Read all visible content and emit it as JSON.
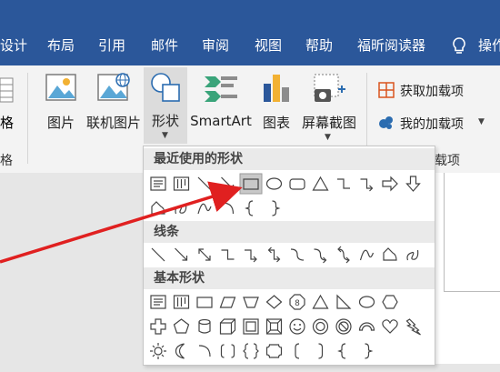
{
  "tabs": [
    "设计",
    "布局",
    "引用",
    "邮件",
    "审阅",
    "视图",
    "帮助",
    "福昕阅读器",
    "操作"
  ],
  "ribbon": {
    "left_partial_label": "格",
    "left_partial_group": "格",
    "picture_label": "图片",
    "online_picture_label": "联机图片",
    "shapes_label": "形状",
    "smartart_label": "SmartArt",
    "chart_label": "图表",
    "screenshot_label": "屏幕截图",
    "get_addins_label": "获取加载项",
    "my_addins_label": "我的加载项",
    "addins_group_label": "载项"
  },
  "dropdown": {
    "recent_header": "最近使用的形状",
    "lines_header": "线条",
    "basic_header": "基本形状",
    "recent_icons": [
      "text-box-icon",
      "vertical-text-box-icon",
      "line-icon",
      "arrow-line-icon",
      "rectangle-icon",
      "oval-icon",
      "rounded-rectangle-icon",
      "triangle-icon",
      "elbow-connector-icon",
      "elbow-arrow-connector-icon",
      "right-arrow-icon",
      "down-arrow-icon",
      "freeform-icon",
      "scribble-icon",
      "curve-icon",
      "arc-icon",
      "left-brace-icon",
      "right-brace-icon"
    ],
    "line_icons": [
      "line-icon",
      "arrow-line-icon",
      "double-arrow-line-icon",
      "elbow-connector-icon",
      "elbow-arrow-connector-icon",
      "elbow-double-arrow-connector-icon",
      "curved-connector-icon",
      "curved-arrow-connector-icon",
      "curved-double-arrow-connector-icon",
      "curve-icon",
      "freeform-icon",
      "scribble-icon"
    ],
    "basic_row1": [
      "text-box-icon",
      "vertical-text-box-icon",
      "rectangle-icon",
      "parallelogram-icon",
      "trapezoid-icon",
      "diamond-icon",
      "octagon-icon",
      "triangle-icon",
      "right-triangle-icon",
      "oval-icon",
      "hexagon-icon"
    ],
    "basic_row2": [
      "cross-icon",
      "pentagon-icon",
      "can-icon",
      "cube-icon",
      "frame-icon",
      "bevel-icon",
      "smiley-icon",
      "donut-icon",
      "no-symbol-icon",
      "block-arc-icon",
      "heart-icon",
      "lightning-icon"
    ],
    "basic_row3": [
      "sun-icon",
      "moon-icon",
      "arc-icon",
      "double-bracket-icon",
      "double-brace-icon",
      "plaque-icon",
      "left-bracket-icon",
      "right-bracket-icon",
      "left-brace-icon",
      "right-brace-icon"
    ]
  },
  "colors": {
    "tabbar": "#2b579a",
    "annotation_arrow": "#e02020",
    "highlight": "#c8c8c8"
  }
}
